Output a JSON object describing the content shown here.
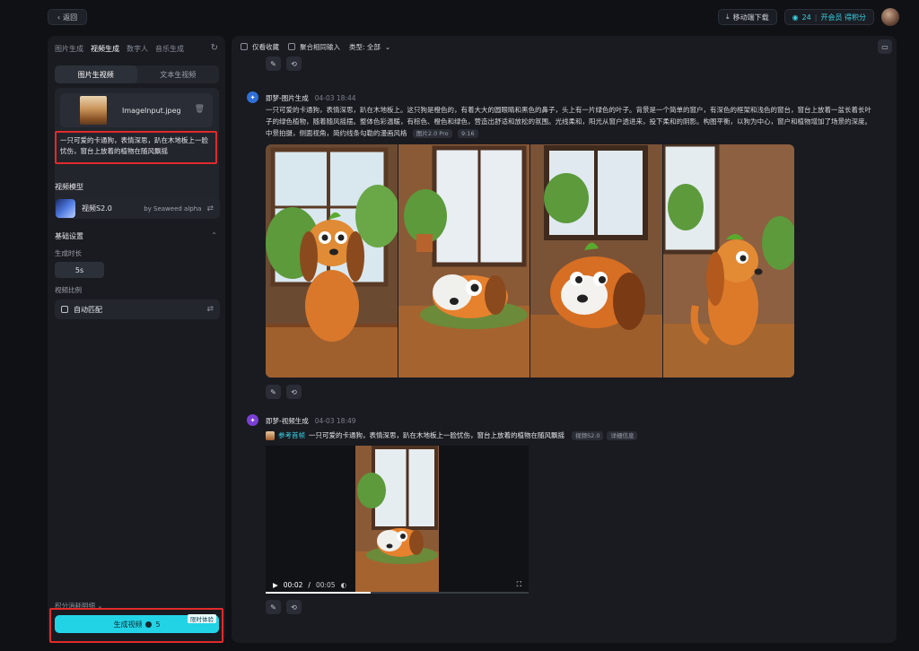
{
  "topbar": {
    "back_label": "返回",
    "mobile_download": "移动端下载",
    "credits": "24",
    "vip_label": "开会员 得积分"
  },
  "left": {
    "tabs": [
      "图片生成",
      "视频生成",
      "数字人",
      "音乐生成"
    ],
    "active_tab": 1,
    "segments": [
      "图片生视频",
      "文本生视频"
    ],
    "active_segment": 0,
    "file_name": "ImageInput.jpeg",
    "prompt": "一只可爱的卡通狗，表情深思，趴在木地板上一脸忧伤，窗台上放着的植物在随风飘摇",
    "model_section": "视频模型",
    "model_name": "视频S2.0",
    "model_by": "by Seaweed alpha",
    "basic_settings": "基础设置",
    "duration_label": "生成时长",
    "duration_value": "5s",
    "ratio_label": "视频比例",
    "ratio_value": "自动匹配",
    "rules_link": "积分消耗明细",
    "generate_label": "生成视频",
    "generate_cost": "5",
    "generate_badge": "限时体验"
  },
  "main": {
    "filters": {
      "favorites_only": "仅看收藏",
      "merge_input": "聚合相同输入",
      "type_label": "类型: 全部"
    },
    "image_entry": {
      "title": "即梦-图片生成",
      "time": "04-03  18:44",
      "prompt": "一只可爱的卡通狗，表情深思，趴在木地板上。这只狗是橙色的，有着大大的圆眼睛和黑色的鼻子，头上有一片绿色的叶子。背景是一个简单的窗户，有深色的框架和浅色的窗台，窗台上放着一盆长着长叶子的绿色植物，随着随风摇摆。整体色彩温暖，有棕色、橙色和绿色，营造出舒适和放松的氛围。光线柔和，阳光从窗户透进来，投下柔和的阴影。构图平衡，以狗为中心，窗户和植物增加了场景的深度。中景拍摄，侧面视角，简约线条勾勒的漫画风格",
      "model_tag": "图片2.0 Pro",
      "ratio_tag": "9:16"
    },
    "video_entry": {
      "title": "即梦-视频生成",
      "time": "04-03  18:49",
      "ref_label": "参考首帧",
      "prompt": "一只可爱的卡通狗，表情深思，趴在木地板上一脸忧伤，窗台上放着的植物在随风飘摇",
      "model_tag": "视频S2.0",
      "detail_tag": "详细信息",
      "current_time": "00:02",
      "duration": "00:05",
      "progress": 0.4
    }
  },
  "colors": {
    "accent": "#22d3e6",
    "highlight_box": "#e22a2a",
    "panel": "#191b21",
    "background": "#0f1115"
  },
  "icons": [
    "chevron-left-icon",
    "download-icon",
    "credit-icon",
    "refresh-icon",
    "trash-icon",
    "adjust-icon",
    "chevron-up-icon",
    "chevron-down-icon",
    "folder-icon",
    "edit-icon",
    "regenerate-icon",
    "play-icon",
    "volume-icon",
    "fullscreen-icon"
  ]
}
